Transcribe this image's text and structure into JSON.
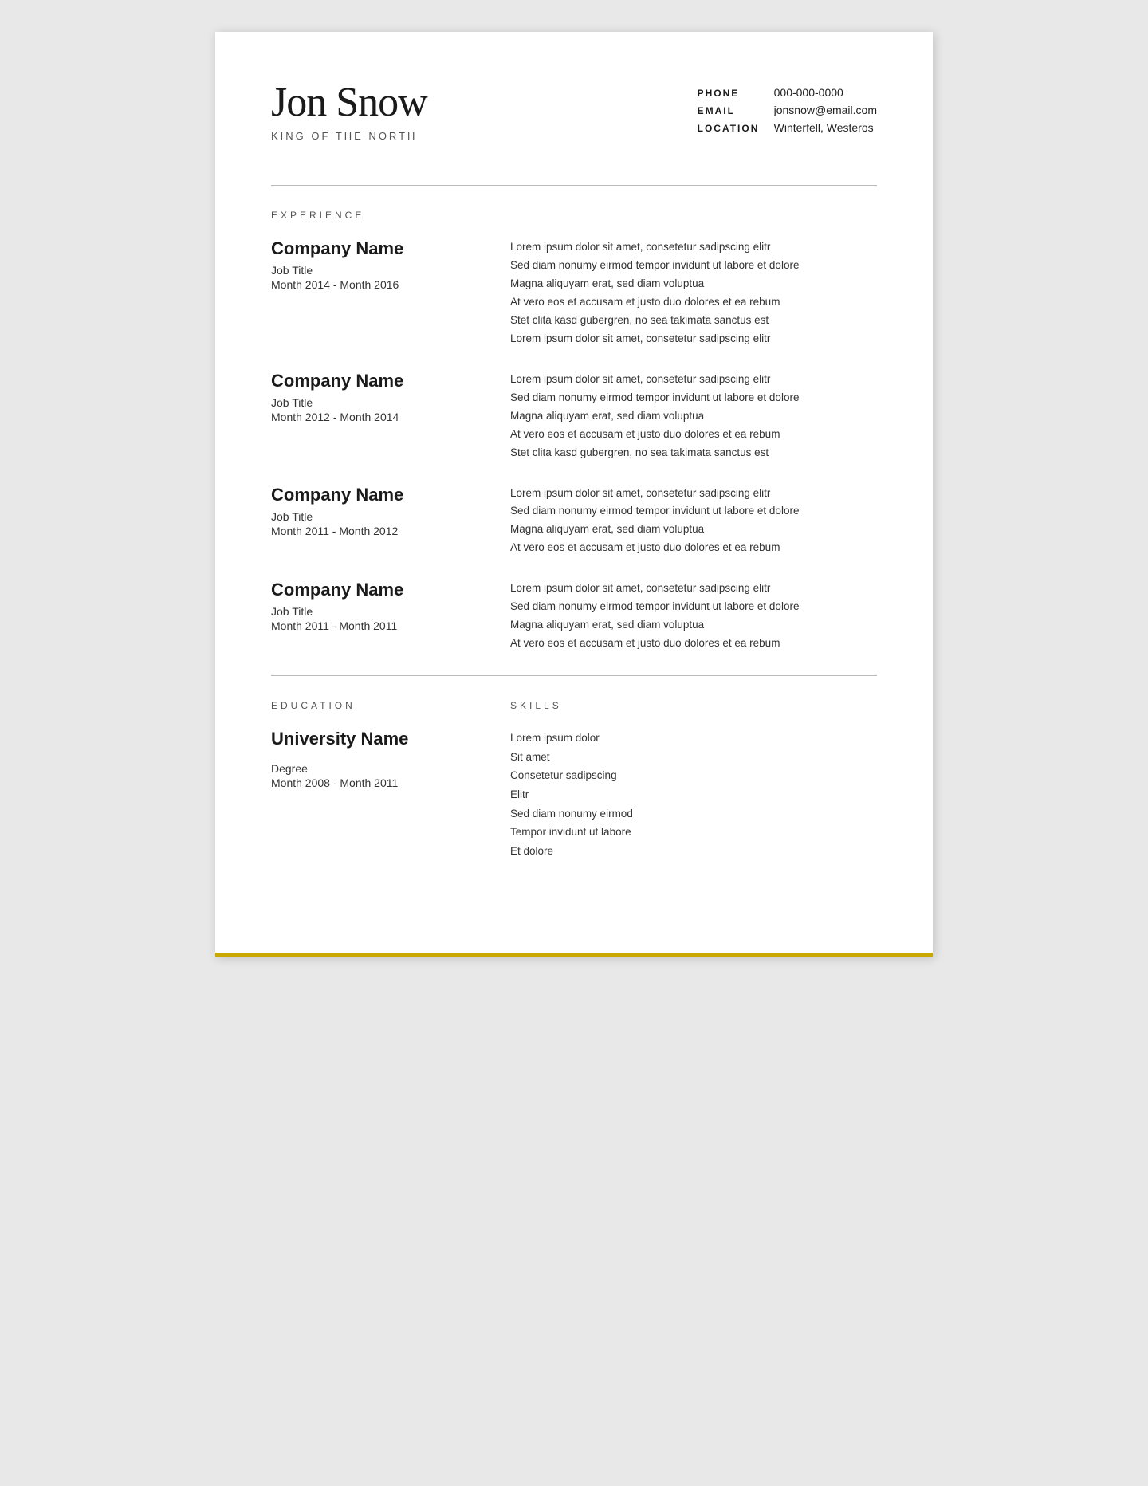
{
  "header": {
    "name": "Jon Snow",
    "subtitle": "KING OF THE NORTH",
    "contact": [
      {
        "label": "PHONE",
        "value": "000-000-0000"
      },
      {
        "label": "EMAIL",
        "value": "jonsnow@email.com"
      },
      {
        "label": "LOCATION",
        "value": "Winterfell, Westeros"
      }
    ]
  },
  "sections": {
    "experience_label": "EXPERIENCE",
    "education_label": "EDUCATION",
    "skills_label": "SKILLS"
  },
  "experience": [
    {
      "company": "Company Name",
      "title": "Job Title",
      "dates": "Month 2014 - Month 2016",
      "description": "Lorem ipsum dolor sit amet, consetetur sadipscing elitr\nSed diam nonumy eirmod tempor invidunt ut labore et dolore\nMagna aliquyam erat, sed diam voluptua\nAt vero eos et accusam et justo duo dolores et ea rebum\nStet clita kasd gubergren, no sea takimata sanctus est\nLorem ipsum dolor sit amet, consetetur sadipscing elitr"
    },
    {
      "company": "Company Name",
      "title": "Job Title",
      "dates": "Month 2012 - Month 2014",
      "description": "Lorem ipsum dolor sit amet, consetetur sadipscing elitr\nSed diam nonumy eirmod tempor invidunt ut labore et dolore\nMagna aliquyam erat, sed diam voluptua\nAt vero eos et accusam et justo duo dolores et ea rebum\nStet clita kasd gubergren, no sea takimata sanctus est"
    },
    {
      "company": "Company Name",
      "title": "Job Title",
      "dates": "Month 2011 - Month 2012",
      "description": "Lorem ipsum dolor sit amet, consetetur sadipscing elitr\nSed diam nonumy eirmod tempor invidunt ut labore et dolore\nMagna aliquyam erat, sed diam voluptua\nAt vero eos et accusam et justo duo dolores et ea rebum"
    },
    {
      "company": "Company Name",
      "title": "Job Title",
      "dates": "Month 2011 - Month 2011",
      "description": "Lorem ipsum dolor sit amet, consetetur sadipscing elitr\nSed diam nonumy eirmod tempor invidunt ut labore et dolore\nMagna aliquyam erat, sed diam voluptua\nAt vero eos et accusam et justo duo dolores et ea rebum"
    }
  ],
  "education": {
    "university": "University Name",
    "degree": "Degree",
    "dates": "Month 2008 - Month 2011"
  },
  "skills": [
    "Lorem ipsum dolor",
    "Sit amet",
    "Consetetur sadipscing",
    "Elitr",
    "Sed diam nonumy eirmod",
    "Tempor invidunt ut labore",
    "Et dolore"
  ]
}
